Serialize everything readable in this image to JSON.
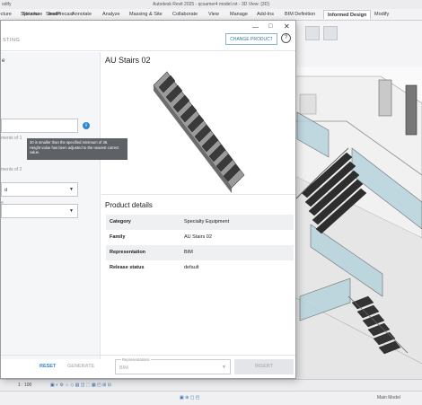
{
  "window": {
    "title": "Autodesk Revit 2025 - qcsamer4 model.rvt - 3D View: {3D}",
    "menu_text": "odify"
  },
  "ribbon": {
    "tabs": [
      "tecture",
      "Structure",
      "Steel",
      "Precast",
      "Systems",
      "Insert",
      "Annotate",
      "Analyze",
      "Massing & Site",
      "Collaborate",
      "View",
      "Manage",
      "Add-Ins",
      "BIM Definition",
      "Informed Design",
      "Modify"
    ],
    "active_tab": "Informed Design"
  },
  "dialog": {
    "header_left": "STING",
    "change_product_label": "CHANGE PRODUCT",
    "help_icon": "help-icon",
    "minimize_icon": "minimize-icon",
    "maximize_icon": "maximize-icon",
    "close_icon": "close-icon",
    "left_panel": {
      "top_fragment": "e",
      "info_icon": "info-icon",
      "label_requirements_1": "ments of 1",
      "label_requirements_2": "ments of 2",
      "select_1_value": "d",
      "label_select_2": "e",
      "reset_label": "RESET",
      "generate_label": "GENERATE"
    },
    "tooltip": {
      "line1": "30 is smaller than the specified minimum of 36.",
      "line2": "Height value has been adjusted to the nearest correct",
      "line3": "value."
    },
    "product": {
      "title": "AU Stairs 02",
      "details_heading": "Product details",
      "details": [
        {
          "key": "Category",
          "value": "Specialty Equipment"
        },
        {
          "key": "Family",
          "value": "AU Stairs 02"
        },
        {
          "key": "Representation",
          "value": "BIM"
        },
        {
          "key": "Release status",
          "value": "default"
        }
      ]
    },
    "footer": {
      "representations_label": "Representations",
      "representation_value": "BIM",
      "insert_label": "INSERT"
    }
  },
  "statusbar": {
    "scale": "1 : 100",
    "right_text": "Main Model"
  }
}
